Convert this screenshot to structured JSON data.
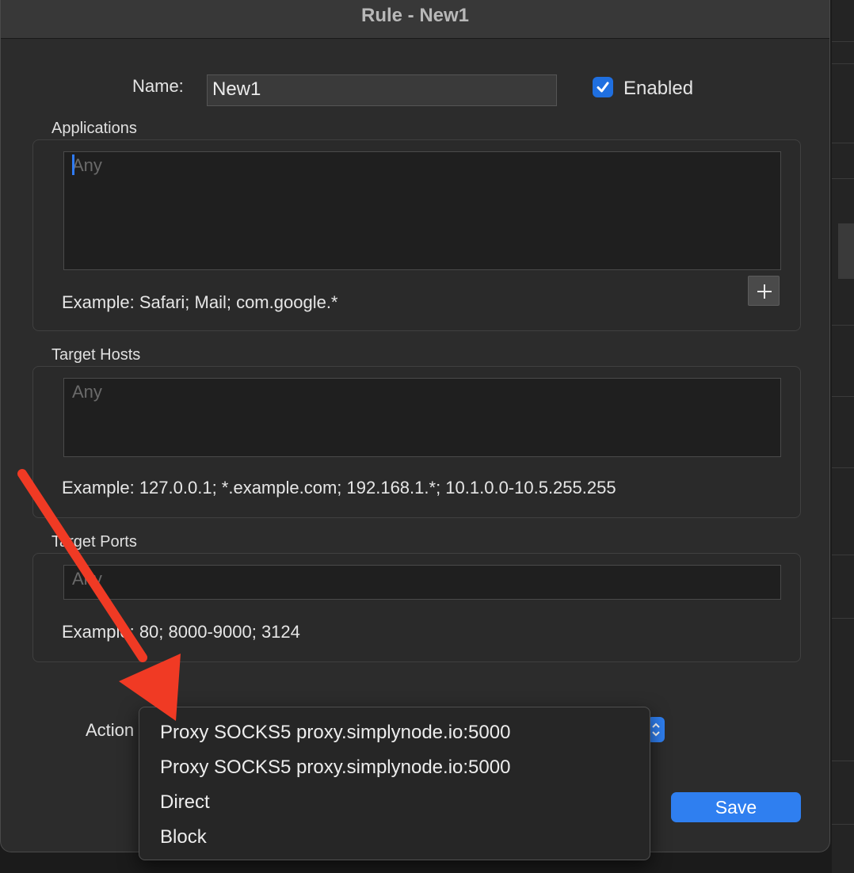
{
  "window": {
    "title": "Rule - New1"
  },
  "form": {
    "name_label": "Name:",
    "name_value": "New1",
    "enabled_label": "Enabled",
    "enabled_checked": true
  },
  "applications": {
    "label": "Applications",
    "placeholder": "Any",
    "example": "Example: Safari; Mail; com.google.*",
    "add_icon": "plus-icon"
  },
  "target_hosts": {
    "label": "Target Hosts",
    "placeholder": "Any",
    "example": "Example: 127.0.0.1; *.example.com; 192.168.1.*; 10.1.0.0-10.5.255.255"
  },
  "target_ports": {
    "label": "Target Ports",
    "placeholder": "Any",
    "example": "Example: 80; 8000-9000; 3124"
  },
  "action": {
    "label": "Action",
    "menu_items": [
      "Proxy SOCKS5 proxy.simplynode.io:5000",
      "Proxy SOCKS5 proxy.simplynode.io:5000",
      "Direct",
      "Block"
    ]
  },
  "buttons": {
    "save_label": "Save"
  },
  "colors": {
    "accent": "#2f7ff0",
    "annotation_arrow": "#f03a24"
  }
}
